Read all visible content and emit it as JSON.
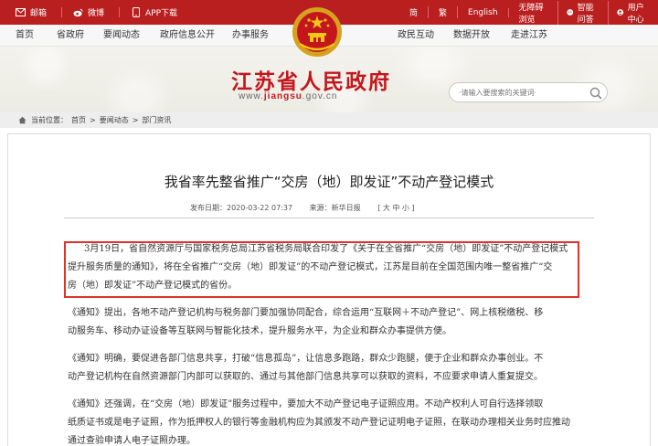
{
  "topbar": {
    "left": [
      {
        "icon": "mail-icon",
        "label": "邮箱"
      },
      {
        "icon": "weibo-icon",
        "label": "微博"
      },
      {
        "icon": "app-icon",
        "label": "APP下载"
      }
    ],
    "right_links": [
      "简",
      "繁",
      "English",
      "无障碍浏览"
    ],
    "smart_qa": "智能问答",
    "user_center": "用户中心"
  },
  "nav": {
    "items": [
      "首页",
      "省政府",
      "要闻动态",
      "政府信息公开",
      "办事服务",
      "政民互动",
      "数据开放",
      "走进江苏"
    ]
  },
  "site": {
    "title": "江苏省人民政府",
    "url_prefix": "www.",
    "url_brand": "jiangsu",
    "url_suffix": ".gov.cn"
  },
  "search": {
    "placeholder": "·请输入要搜索的关键词·"
  },
  "breadcrumb": {
    "label": "当前位置：",
    "items": [
      "首页",
      "要闻动态",
      "部门资讯"
    ],
    "separator": ">"
  },
  "article": {
    "title": "我省率先整省推广“交房（地）即发证”不动产登记模式",
    "date": "发布日期：2020-03-22 07:37",
    "source": "来源：新华日报",
    "font_size": "[ 大 中 小 ]",
    "lines": [
      "3月19日，省自然资源厅与国家税务总局江苏省税务局联合印发了《关于在全省推广“交房（地）即发证”不动产登记模式",
      "提升服务质量的通知》，将在全省推广“交房（地）即发证”的不动产登记模式，江苏是目前在全国范围内唯一整省推广“交",
      "房（地）即发证”不动产登记模式的省份。",
      "《通知》提出，各地不动产登记机构与税务部门要加强协同配合，综合运用“互联网＋不动产登记”、网上核税缴税、移",
      "动服务车、移动办证设备等互联网与智能化技术，提升服务水平，为企业和群众办事提供方便。",
      "《通知》明确，要促进各部门信息共享，打破“信息孤岛”，让信息多跑路，群众少跑腿，便于企业和群众办事创业。不",
      "动产登记机构在自然资源部门内部可以获取的、通过与其他部门信息共享可以获取的资料，不应要求申请人重复提交。",
      "《通知》还强调，在“交房（地）即发证”服务过程中，要加大不动产登记电子证照应用。不动产权利人可自行选择领取",
      "纸质证书或是电子证照，作为抵押权人的银行等金融机构应为其颁发不动产登记证明电子证照，在联动办理相关业务时应推动",
      "通过查验申请人电子证照办理。"
    ]
  },
  "colors": {
    "topbar": "#b91f1f",
    "brand_red": "#c4161c",
    "highlight_border": "#e0312b"
  }
}
